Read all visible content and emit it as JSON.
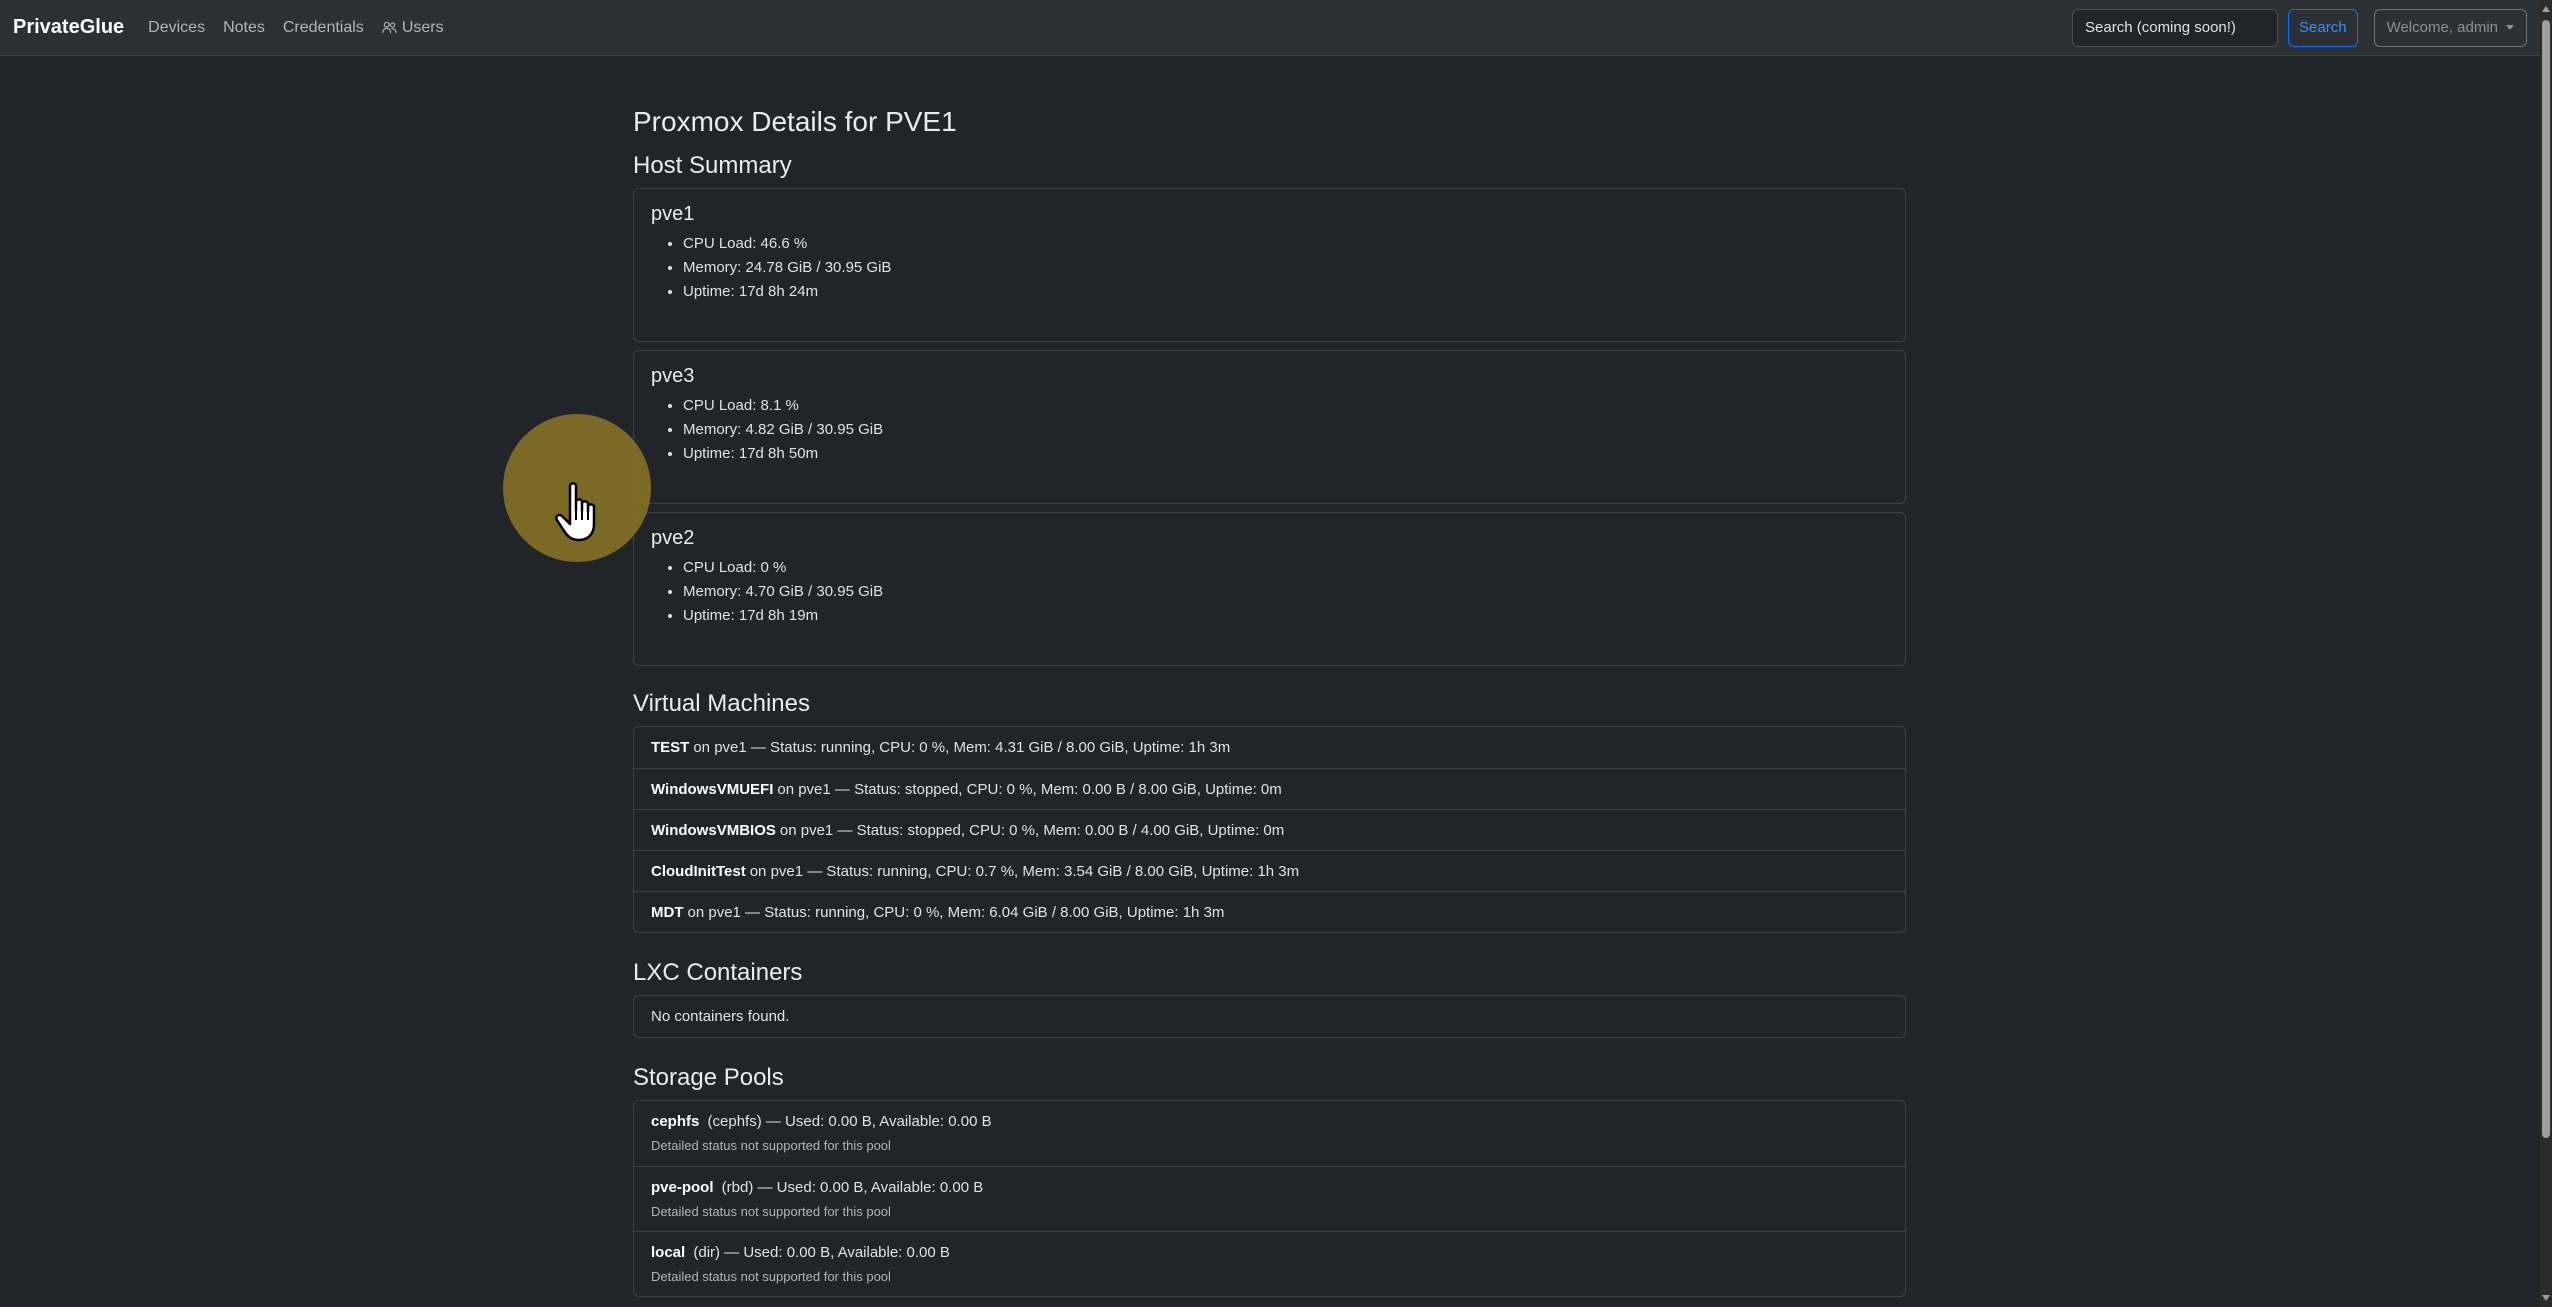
{
  "navbar": {
    "brand": "PrivateGlue",
    "links": [
      "Devices",
      "Notes",
      "Credentials",
      "Users"
    ],
    "search_placeholder": "Search (coming soon!)",
    "search_button": "Search",
    "welcome": "Welcome, admin",
    "accent": "#0d6efd"
  },
  "page": {
    "title": "Proxmox Details for PVE1"
  },
  "host_summary": {
    "heading": "Host Summary",
    "hosts": [
      {
        "name": "pve1",
        "cpu": "CPU Load: 46.6 %",
        "memory": "Memory: 24.78 GiB / 30.95 GiB",
        "uptime": "Uptime: 17d 8h 24m"
      },
      {
        "name": "pve3",
        "cpu": "CPU Load: 8.1 %",
        "memory": "Memory: 4.82 GiB / 30.95 GiB",
        "uptime": "Uptime: 17d 8h 50m"
      },
      {
        "name": "pve2",
        "cpu": "CPU Load: 0 %",
        "memory": "Memory: 4.70 GiB / 30.95 GiB",
        "uptime": "Uptime: 17d 8h 19m"
      }
    ]
  },
  "virtual_machines": {
    "heading": "Virtual Machines",
    "items": [
      {
        "name": "TEST",
        "detail": "on pve1 — Status: running, CPU: 0 %, Mem: 4.31 GiB / 8.00 GiB, Uptime: 1h 3m"
      },
      {
        "name": "WindowsVMUEFI",
        "detail": "on pve1 — Status: stopped, CPU: 0 %, Mem: 0.00 B / 8.00 GiB, Uptime: 0m"
      },
      {
        "name": "WindowsVMBIOS",
        "detail": "on pve1 — Status: stopped, CPU: 0 %, Mem: 0.00 B / 4.00 GiB, Uptime: 0m"
      },
      {
        "name": "CloudInitTest",
        "detail": "on pve1 — Status: running, CPU: 0.7 %, Mem: 3.54 GiB / 8.00 GiB, Uptime: 1h 3m"
      },
      {
        "name": "MDT",
        "detail": "on pve1 — Status: running, CPU: 0 %, Mem: 6.04 GiB / 8.00 GiB, Uptime: 1h 3m"
      }
    ]
  },
  "lxc": {
    "heading": "LXC Containers",
    "empty": "No containers found."
  },
  "storage": {
    "heading": "Storage Pools",
    "items": [
      {
        "name": "cephfs",
        "detail": "(cephfs) — Used: 0.00 B, Available: 0.00 B",
        "note": "Detailed status not supported for this pool"
      },
      {
        "name": "pve-pool",
        "detail": "(rbd) — Used: 0.00 B, Available: 0.00 B",
        "note": "Detailed status not supported for this pool"
      },
      {
        "name": "local",
        "detail": "(dir) — Used: 0.00 B, Available: 0.00 B",
        "note": "Detailed status not supported for this pool"
      }
    ]
  },
  "icons": {
    "users": "people-icon",
    "cursor": "hand-pointer-icon"
  }
}
